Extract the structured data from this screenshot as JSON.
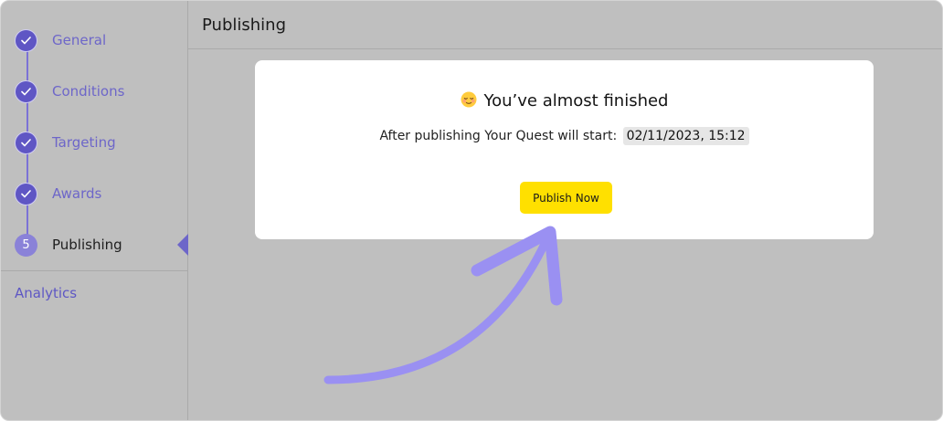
{
  "sidebar": {
    "steps": [
      {
        "label": "General",
        "status": "done"
      },
      {
        "label": "Conditions",
        "status": "done"
      },
      {
        "label": "Targeting",
        "status": "done"
      },
      {
        "label": "Awards",
        "status": "done"
      },
      {
        "label": "Publishing",
        "status": "current",
        "number": "5"
      }
    ],
    "analytics_label": "Analytics"
  },
  "main": {
    "title": "Publishing"
  },
  "card": {
    "emoji_icon": "relieved-face-icon",
    "heading": "You’ve almost finished",
    "start_text": "After publishing Your Quest will start:",
    "start_date": "02/11/2023, 15:12",
    "publish_button_label": "Publish Now"
  },
  "colors": {
    "background": "#bfbfbf",
    "accent": "#6d66c9",
    "step_circle": "#5f56c4",
    "button": "#ffe000",
    "annotation_arrow": "#9a90f2"
  }
}
